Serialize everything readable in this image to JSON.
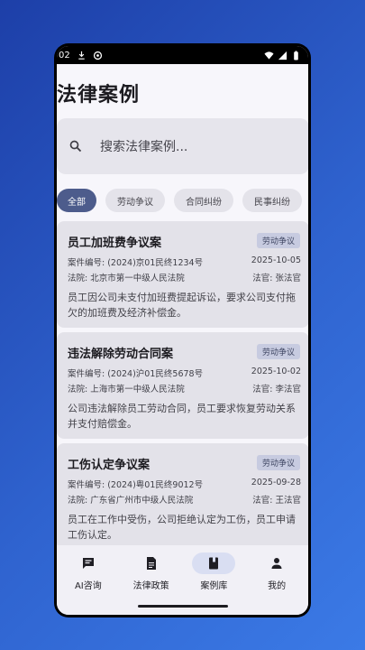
{
  "status_bar": {
    "time": "02"
  },
  "page": {
    "title": "法律案例"
  },
  "search": {
    "placeholder": "搜索法律案例..."
  },
  "filters": [
    "全部",
    "劳动争议",
    "合同纠纷",
    "民事纠纷"
  ],
  "cases": [
    {
      "title": "员工加班费争议案",
      "tag": "劳动争议",
      "case_number": "案件编号: (2024)京01民终1234号",
      "date": "2025-10-05",
      "court": "法院: 北京市第一中级人民法院",
      "judge": "法官: 张法官",
      "description": "员工因公司未支付加班费提起诉讼，要求公司支付拖欠的加班费及经济补偿金。"
    },
    {
      "title": "违法解除劳动合同案",
      "tag": "劳动争议",
      "case_number": "案件编号: (2024)沪01民终5678号",
      "date": "2025-10-02",
      "court": "法院: 上海市第一中级人民法院",
      "judge": "法官: 李法官",
      "description": "公司违法解除员工劳动合同，员工要求恢复劳动关系并支付赔偿金。"
    },
    {
      "title": "工伤认定争议案",
      "tag": "劳动争议",
      "case_number": "案件编号: (2024)粤01民终9012号",
      "date": "2025-09-28",
      "court": "法院: 广东省广州市中级人民法院",
      "judge": "法官: 王法官",
      "description": "员工在工作中受伤，公司拒绝认定为工伤，员工申请工伤认定。"
    }
  ],
  "bottom_nav": [
    {
      "label": "AI咨询",
      "icon": "chat-icon"
    },
    {
      "label": "法律政策",
      "icon": "document-icon"
    },
    {
      "label": "案例库",
      "icon": "book-icon",
      "active": true
    },
    {
      "label": "我的",
      "icon": "person-icon"
    }
  ],
  "colors": {
    "accent": "#4d5c8c",
    "card_bg": "#e3e2e9",
    "tag_bg": "#c7cbe0",
    "nav_active_bg": "#d9def2"
  }
}
